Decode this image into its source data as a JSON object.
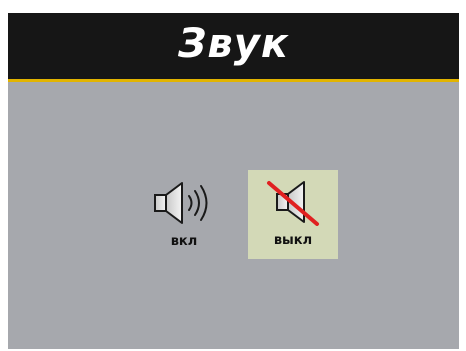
{
  "screen": {
    "title": "Звук"
  },
  "options": {
    "on": {
      "label": "вкл",
      "icon": "speaker-on-icon",
      "selected": false
    },
    "off": {
      "label": "выкл",
      "icon": "speaker-muted-icon",
      "selected": true
    }
  },
  "colors": {
    "title_bar": "#161616",
    "accent_line": "#e2b400",
    "panel_bg": "#a6a8ad",
    "selected_bg": "#d3d9b7",
    "mute_slash": "#e02020"
  }
}
